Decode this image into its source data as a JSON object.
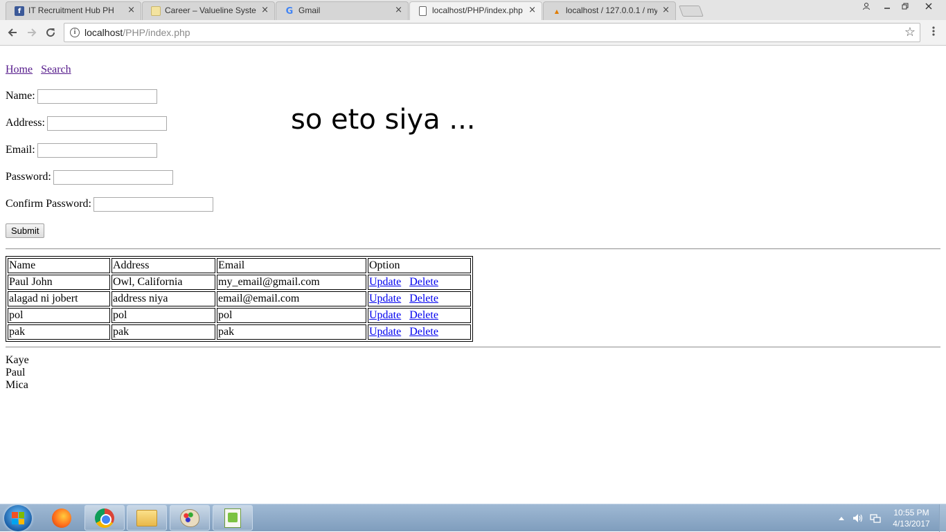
{
  "browser": {
    "tabs": [
      {
        "title": "IT Recruitment Hub PH",
        "favicon": "facebook-icon"
      },
      {
        "title": "Career – Valueline System",
        "favicon": "page-icon"
      },
      {
        "title": "Gmail",
        "favicon": "google-icon"
      },
      {
        "title": "localhost/PHP/index.php",
        "favicon": "document-icon",
        "active": true
      },
      {
        "title": "localhost / 127.0.0.1 / my",
        "favicon": "phpmyadmin-icon"
      }
    ],
    "close_glyph": "×",
    "url_host": "localhost",
    "url_path": "/PHP/index.php"
  },
  "nav": {
    "home_label": "Home",
    "search_label": "Search"
  },
  "form": {
    "name_label": "Name:",
    "address_label": "Address:",
    "email_label": "Email:",
    "password_label": "Password:",
    "confirm_password_label": "Confirm Password:",
    "submit_label": "Submit"
  },
  "overlay_text": "so eto siya ...",
  "table": {
    "headers": [
      "Name",
      "Address",
      "Email",
      "Option"
    ],
    "rows": [
      {
        "name": "Paul John",
        "address": "Owl, California",
        "email": "my_email@gmail.com"
      },
      {
        "name": "alagad ni jobert",
        "address": "address niya",
        "email": "email@email.com"
      },
      {
        "name": "pol",
        "address": "pol",
        "email": "pol"
      },
      {
        "name": "pak",
        "address": "pak",
        "email": "pak"
      }
    ],
    "update_label": "Update",
    "delete_label": "Delete"
  },
  "names_list": [
    "Kaye",
    "Paul",
    "Mica"
  ],
  "taskbar": {
    "time": "10:55 PM",
    "date": "4/13/2017"
  },
  "colors": {
    "link_visited": "#551a8b",
    "link": "#0000ee",
    "taskbar": "#9fb9d4"
  }
}
